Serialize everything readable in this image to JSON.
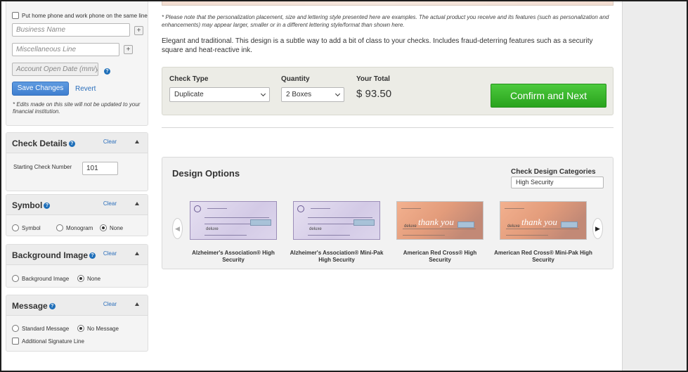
{
  "sidebar": {
    "same_line_checkbox": "Put home phone and work phone on the same line",
    "business_name_placeholder": "Business Name",
    "misc_line_placeholder": "Miscellaneous Line",
    "account_open_placeholder": "Account Open Date (mm/yy",
    "add_symbol": "+",
    "help_symbol": "?",
    "save_label": "Save Changes",
    "revert_label": "Revert",
    "note": "* Edits made on this site will not be updated to your financial institution."
  },
  "check_details": {
    "title": "Check Details",
    "clear": "Clear",
    "starting_label": "Starting Check Number",
    "starting_value": "101"
  },
  "symbol": {
    "title": "Symbol",
    "clear": "Clear",
    "options": [
      "Symbol",
      "Monogram",
      "None"
    ],
    "selected": "None"
  },
  "background_image": {
    "title": "Background Image",
    "clear": "Clear",
    "options": [
      "Background Image",
      "None"
    ],
    "selected": "None"
  },
  "message": {
    "title": "Message",
    "clear": "Clear",
    "options": [
      "Standard Message",
      "No Message"
    ],
    "selected": "No Message",
    "signature_checkbox": "Additional Signature Line"
  },
  "main": {
    "disclaimer": "* Please note that the personalization placement, size and lettering style presented here are examples. The actual product you receive and its features (such as personalization and enhancements) may appear larger, smaller or in a different lettering style/format than shown here.",
    "description": "Elegant and traditional. This design is a subtle way to add a bit of class to your checks. Includes fraud-deterring features such as a security square and heat-reactive ink."
  },
  "order": {
    "check_type_label": "Check Type",
    "check_type_value": "Duplicate",
    "quantity_label": "Quantity",
    "quantity_value": "2 Boxes",
    "total_label": "Your Total",
    "total_value": "$ 93.50",
    "confirm_label": "Confirm and Next"
  },
  "design": {
    "title": "Design Options",
    "category_label": "Check Design Categories",
    "category_value": "High Security",
    "prev_arrow": "◀",
    "next_arrow": "▶",
    "thank_you_text": "thank you",
    "deluxe_text": "deluxe",
    "items": [
      {
        "caption": "Alzheimer's Association® High Security",
        "style": "purple"
      },
      {
        "caption": "Alzheimer's Association® Mini-Pak High Security",
        "style": "purple"
      },
      {
        "caption": "American Red Cross® High Security",
        "style": "orange"
      },
      {
        "caption": "American Red Cross® Mini-Pak High Security",
        "style": "orange"
      }
    ]
  },
  "colors": {
    "link": "#2a6ebb",
    "save_button": "#4a89d8",
    "confirm_button": "#2fa824",
    "help_icon": "#1f6fb9"
  }
}
